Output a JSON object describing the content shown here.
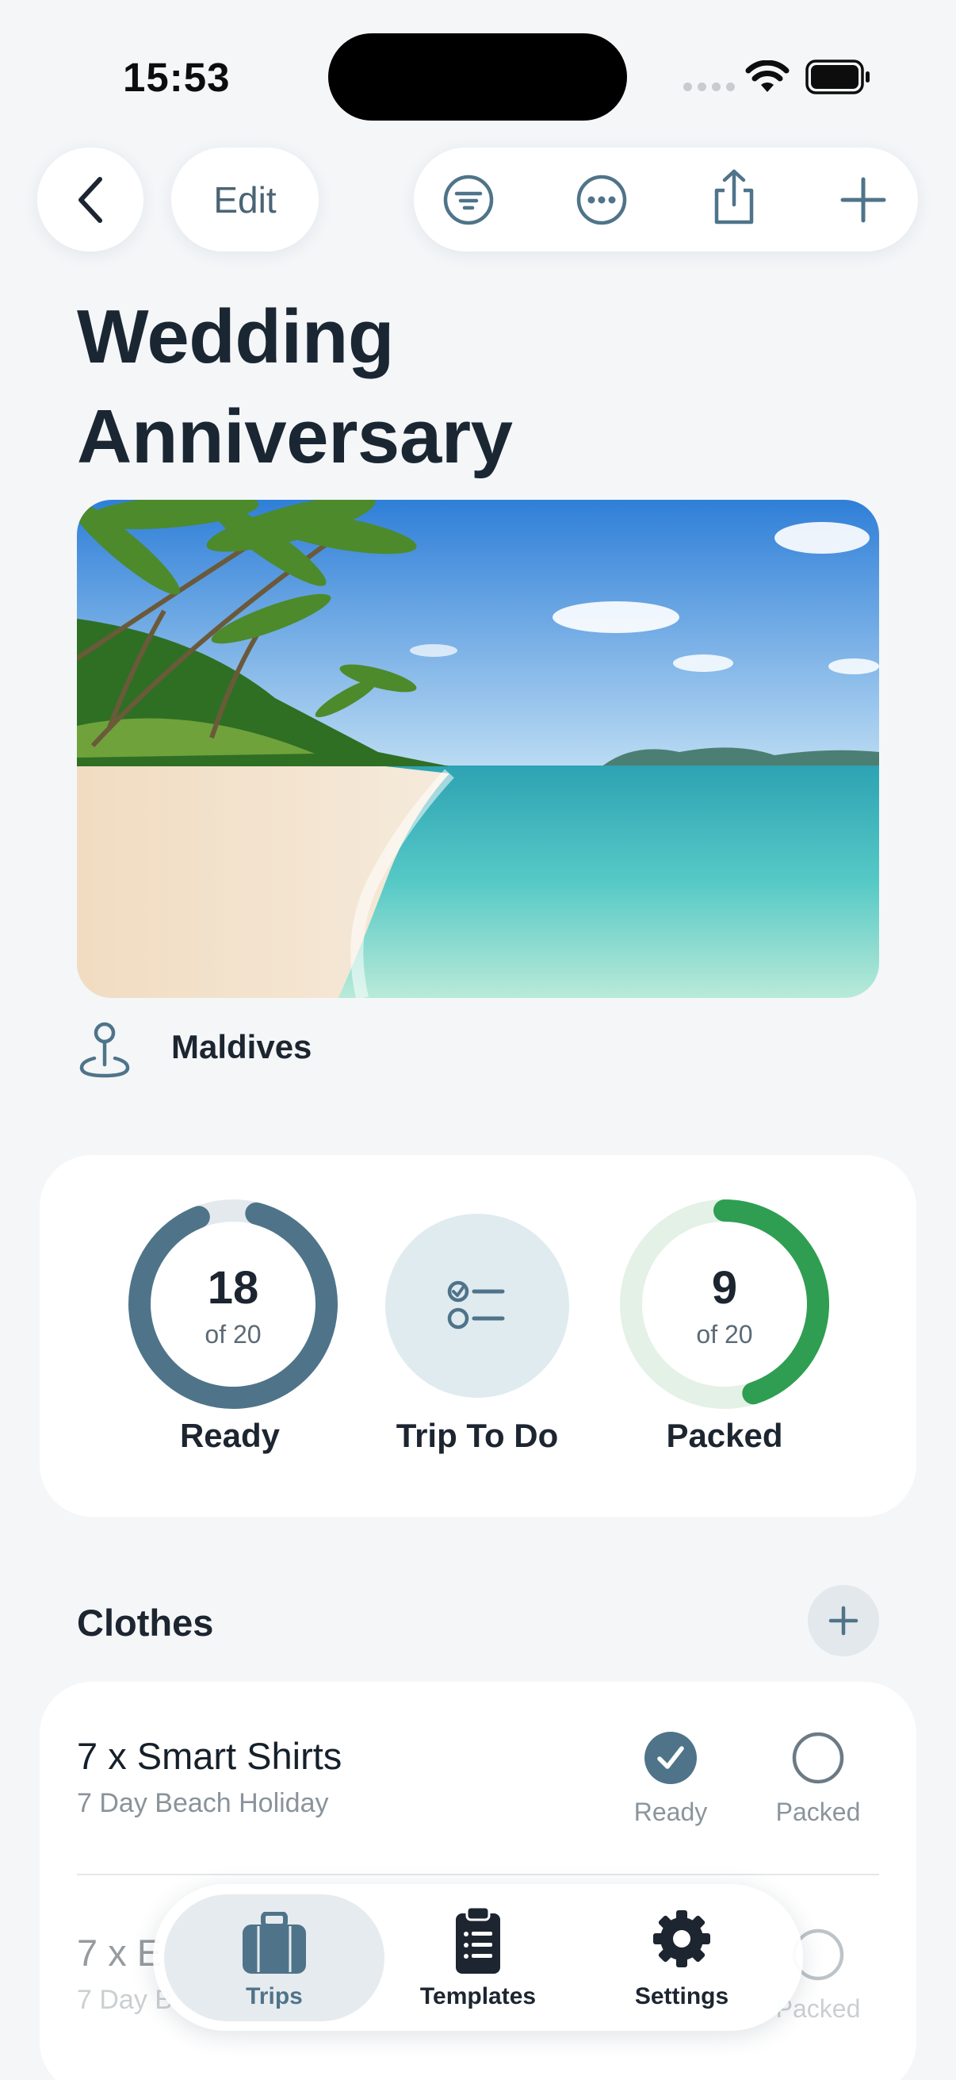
{
  "status_bar": {
    "time": "15:53"
  },
  "nav": {
    "edit_label": "Edit"
  },
  "trip": {
    "title_line1": "Wedding",
    "title_line2": "Anniversary",
    "location": "Maldives"
  },
  "stats": {
    "ready": {
      "count": "18",
      "of": "of 20",
      "label": "Ready",
      "fraction": 0.9
    },
    "todo": {
      "label": "Trip To Do"
    },
    "packed": {
      "count": "9",
      "of": "of 20",
      "label": "Packed",
      "fraction": 0.45
    }
  },
  "section": {
    "title": "Clothes"
  },
  "items": [
    {
      "title": "7 x Smart Shirts",
      "subtitle": "7 Day Beach Holiday",
      "ready_label": "Ready",
      "packed_label": "Packed",
      "ready": true,
      "packed": false
    },
    {
      "title": "7 x E",
      "subtitle": "7 Day B",
      "ready_label": "Ready",
      "packed_label": "Packed",
      "ready": true,
      "packed": false
    }
  ],
  "tabs": [
    {
      "label": "Trips",
      "active": true
    },
    {
      "label": "Templates",
      "active": false
    },
    {
      "label": "Settings",
      "active": false
    }
  ],
  "colors": {
    "accent": "#4f7489",
    "packed_green": "#2f9e52",
    "ring_track": "#e3e9ed",
    "green_track": "#e3f1e6"
  }
}
